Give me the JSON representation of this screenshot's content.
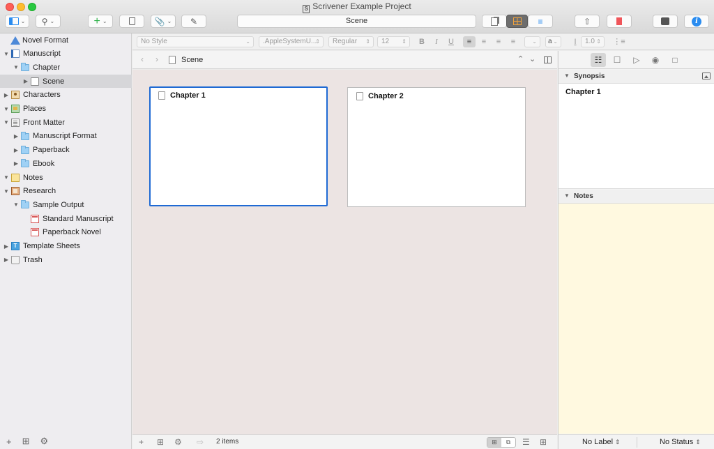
{
  "window": {
    "title": "Scrivener Example Project",
    "breadcrumb_field": "Scene"
  },
  "toolbar": {
    "icons": [
      "binder-toggle-icon",
      "search-icon",
      "add-icon",
      "trash-icon",
      "link-icon",
      "edit-icon",
      "single-view-icon",
      "corkboard-icon",
      "outline-icon",
      "share-icon",
      "bookmark-icon",
      "composition-icon",
      "info-icon"
    ]
  },
  "binder": {
    "items": [
      {
        "label": "Novel Format",
        "icon": "warning-triangle-icon",
        "disclosure": "",
        "indent": 0
      },
      {
        "label": "Manuscript",
        "icon": "manuscript-icon",
        "disclosure": "▼",
        "indent": 0
      },
      {
        "label": "Chapter",
        "icon": "folder-icon",
        "disclosure": "▼",
        "indent": 1
      },
      {
        "label": "Scene",
        "icon": "document-icon",
        "disclosure": "▶",
        "indent": 2
      },
      {
        "label": "Characters",
        "icon": "characters-icon",
        "disclosure": "▶",
        "indent": 0
      },
      {
        "label": "Places",
        "icon": "places-icon",
        "disclosure": "▼",
        "indent": 0
      },
      {
        "label": "Front Matter",
        "icon": "front-matter-icon",
        "disclosure": "▼",
        "indent": 0
      },
      {
        "label": "Manuscript Format",
        "icon": "folder-icon",
        "disclosure": "▶",
        "indent": 1
      },
      {
        "label": "Paperback",
        "icon": "folder-icon",
        "disclosure": "▶",
        "indent": 1
      },
      {
        "label": "Ebook",
        "icon": "folder-icon",
        "disclosure": "▶",
        "indent": 1
      },
      {
        "label": "Notes",
        "icon": "notes-icon",
        "disclosure": "▼",
        "indent": 0
      },
      {
        "label": "Research",
        "icon": "research-icon",
        "disclosure": "▼",
        "indent": 0
      },
      {
        "label": "Sample Output",
        "icon": "folder-icon",
        "disclosure": "▼",
        "indent": 1
      },
      {
        "label": "Standard Manuscript",
        "icon": "pdf-icon",
        "disclosure": "",
        "indent": 2
      },
      {
        "label": "Paperback Novel",
        "icon": "pdf-icon",
        "disclosure": "",
        "indent": 2
      },
      {
        "label": "Template Sheets",
        "icon": "template-icon",
        "disclosure": "▶",
        "indent": 0
      },
      {
        "label": "Trash",
        "icon": "trash-icon",
        "disclosure": "▶",
        "indent": 0
      }
    ],
    "selected_index": 3,
    "footer": {
      "add": "+",
      "add_folder": "⊞",
      "settings": "⚙"
    }
  },
  "format_bar": {
    "style": "No Style",
    "font": ".AppleSystemU...",
    "weight": "Regular",
    "size": "12",
    "bold": "B",
    "italic": "I",
    "underline": "U",
    "line_spacing": "1.0",
    "highlight": "a"
  },
  "editor": {
    "header_title": "Scene",
    "cards": [
      {
        "title": "Chapter 1",
        "selected": true
      },
      {
        "title": "Chapter 2",
        "selected": false
      }
    ],
    "footer_count": "2 items"
  },
  "inspector": {
    "synopsis_label": "Synopsis",
    "synopsis_text": "Chapter 1",
    "notes_label": "Notes",
    "label_select": "No Label",
    "status_select": "No Status"
  },
  "colors": {
    "selection_blue": "#1f6ad4",
    "corkboard_bg": "#ece4e3",
    "notes_bg": "#fff9e0",
    "add_green": "#2fb24a",
    "info_blue": "#2a8cf0"
  }
}
